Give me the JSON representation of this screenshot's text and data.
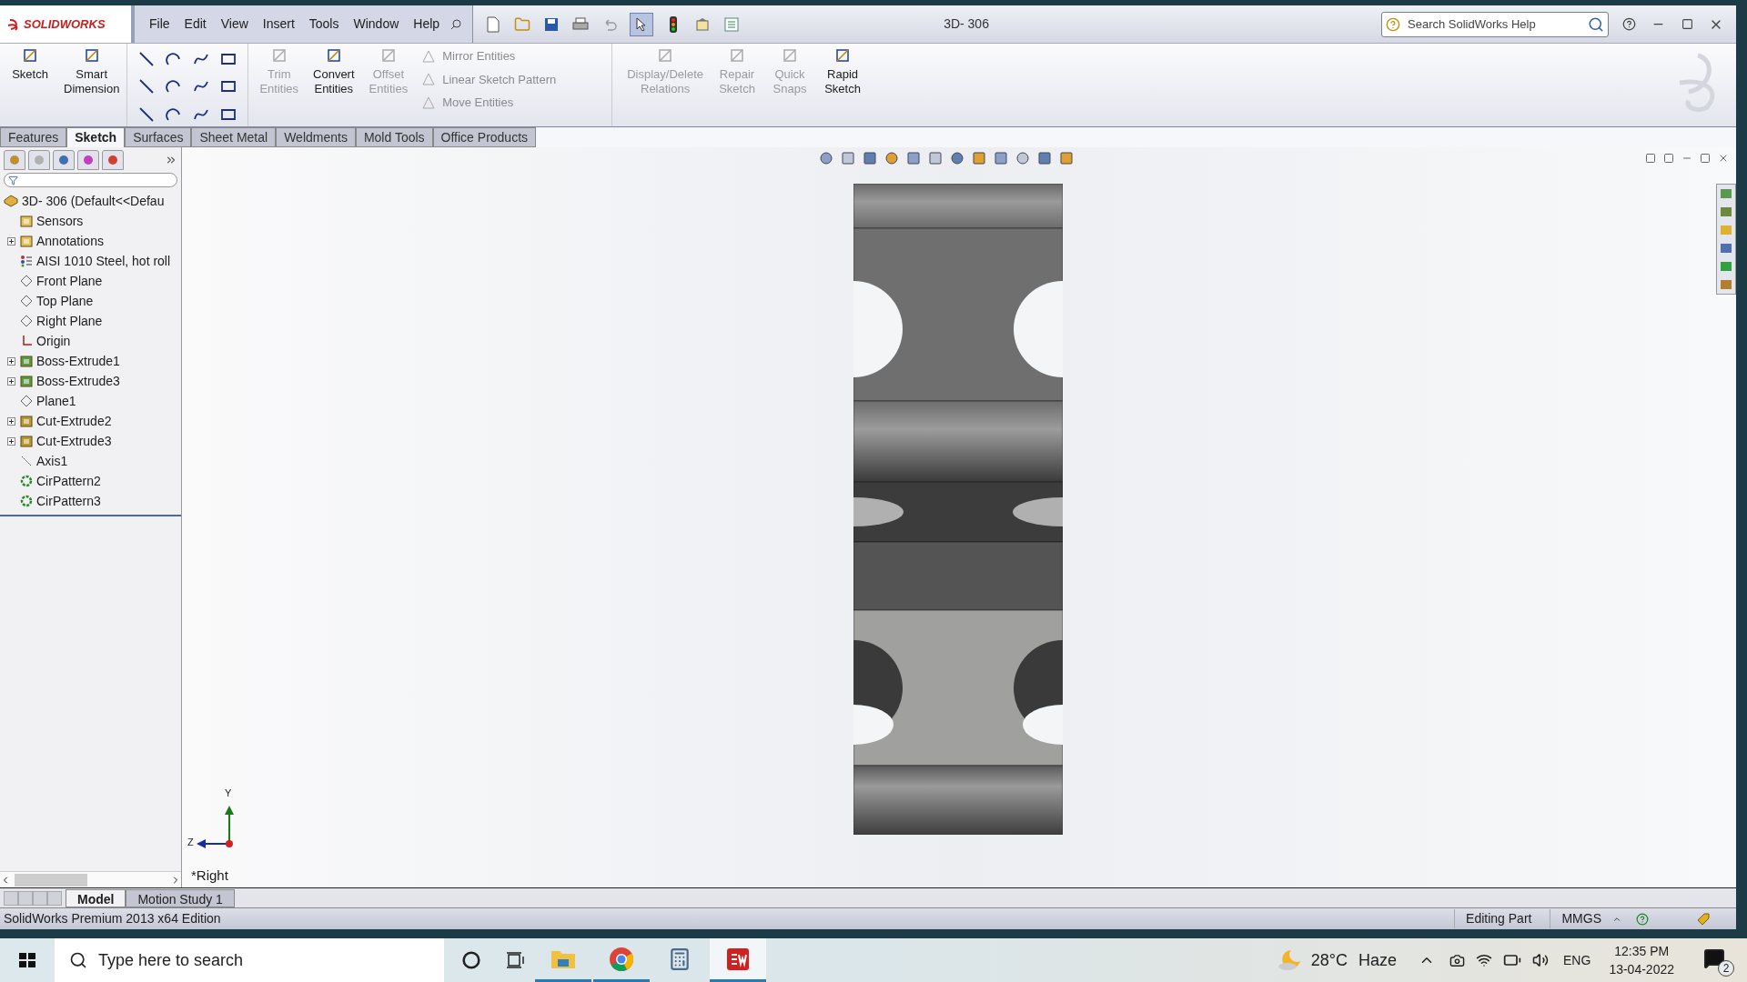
{
  "app": {
    "logo": "SOLIDWORKS",
    "menu": [
      "File",
      "Edit",
      "View",
      "Insert",
      "Tools",
      "Window",
      "Help"
    ],
    "title": "3D- 306",
    "search_placeholder": "Search SolidWorks Help"
  },
  "ribbon": {
    "large": [
      {
        "label": "Sketch",
        "disabled": false
      },
      {
        "label": "Smart Dimension",
        "disabled": false
      }
    ],
    "large2": [
      {
        "label": "Trim Entities",
        "disabled": true
      },
      {
        "label": "Convert Entities",
        "disabled": false
      },
      {
        "label": "Offset Entities",
        "disabled": true
      }
    ],
    "list": [
      {
        "label": "Mirror Entities",
        "disabled": true
      },
      {
        "label": "Linear Sketch Pattern",
        "disabled": true
      },
      {
        "label": "Move Entities",
        "disabled": true
      }
    ],
    "large3": [
      {
        "label": "Display/Delete Relations",
        "disabled": true
      },
      {
        "label": "Repair Sketch",
        "disabled": true
      },
      {
        "label": "Quick Snaps",
        "disabled": true
      },
      {
        "label": "Rapid Sketch",
        "disabled": false
      }
    ]
  },
  "tabs": [
    {
      "label": "Features",
      "selected": false
    },
    {
      "label": "Sketch",
      "selected": true
    },
    {
      "label": "Surfaces",
      "selected": false
    },
    {
      "label": "Sheet Metal",
      "selected": false
    },
    {
      "label": "Weldments",
      "selected": false
    },
    {
      "label": "Mold Tools",
      "selected": false
    },
    {
      "label": "Office Products",
      "selected": false
    }
  ],
  "tree": {
    "label": "3D- 306  (Default<<Defau",
    "children": [
      {
        "label": "Sensors",
        "kind": "folder",
        "collapsed": false
      },
      {
        "label": "Annotations",
        "kind": "annotation",
        "collapsed": true
      },
      {
        "label": "AISI 1010 Steel, hot roll",
        "kind": "material",
        "collapsed": false
      },
      {
        "label": "Front Plane",
        "kind": "plane",
        "collapsed": false
      },
      {
        "label": "Top Plane",
        "kind": "plane",
        "collapsed": false
      },
      {
        "label": "Right Plane",
        "kind": "plane",
        "collapsed": false
      },
      {
        "label": "Origin",
        "kind": "origin",
        "collapsed": false
      },
      {
        "label": "Boss-Extrude1",
        "kind": "boss",
        "collapsed": true
      },
      {
        "label": "Boss-Extrude3",
        "kind": "boss",
        "collapsed": true
      },
      {
        "label": "Plane1",
        "kind": "plane",
        "collapsed": false
      },
      {
        "label": "Cut-Extrude2",
        "kind": "cut",
        "collapsed": true
      },
      {
        "label": "Cut-Extrude3",
        "kind": "cut",
        "collapsed": true
      },
      {
        "label": "Axis1",
        "kind": "axis",
        "collapsed": false
      },
      {
        "label": "CirPattern2",
        "kind": "pattern",
        "collapsed": false
      },
      {
        "label": "CirPattern3",
        "kind": "pattern",
        "collapsed": false
      }
    ]
  },
  "viewport": {
    "view_name": "*Right",
    "axis_y": "Y",
    "axis_z": "Z"
  },
  "bottom_tabs": [
    {
      "label": "Model",
      "selected": true
    },
    {
      "label": "Motion Study 1",
      "selected": false
    }
  ],
  "status_bar": {
    "edition": "SolidWorks Premium 2013 x64 Edition",
    "mode": "Editing Part",
    "units": "MMGS"
  },
  "taskbar": {
    "search_placeholder": "Type here to search",
    "apps": [
      {
        "kind": "explorer",
        "running": true,
        "selected": false
      },
      {
        "kind": "chrome",
        "running": true,
        "selected": false
      },
      {
        "kind": "calculator",
        "running": false,
        "selected": false
      },
      {
        "kind": "solidworks",
        "running": true,
        "selected": true
      }
    ],
    "temperature": "28°C",
    "weather": "Haze",
    "language": "ENG",
    "time": "12:35 PM",
    "date": "13-04-2022",
    "notifications": "2"
  }
}
